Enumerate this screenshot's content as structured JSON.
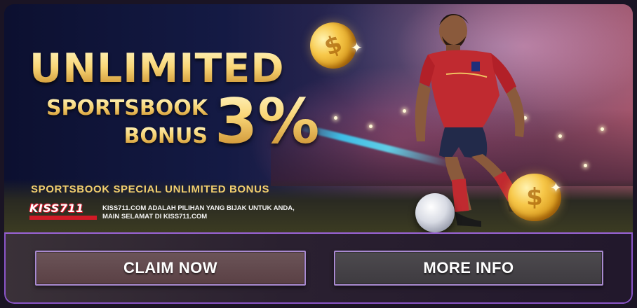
{
  "banner": {
    "headline": "UNLIMITED",
    "line1": "SPORTSBOOK",
    "line2": "BONUS",
    "percent": "3%",
    "subheadline": "SPORTSBOOK SPECIAL UNLIMITED BONUS",
    "logo_text": "KISS711",
    "tagline_line1": "KISS711.COM ADALAH PILIHAN YANG BIJAK UNTUK ANDA,",
    "tagline_line2": "MAIN SELAMAT DI KISS711.COM"
  },
  "buttons": {
    "claim_label": "CLAIM NOW",
    "more_label": "MORE INFO"
  },
  "colors": {
    "gold": "#f7c862",
    "button_border": "#a98ad0",
    "footer_border": "#8a55c8",
    "logo_red": "#d11a26"
  }
}
